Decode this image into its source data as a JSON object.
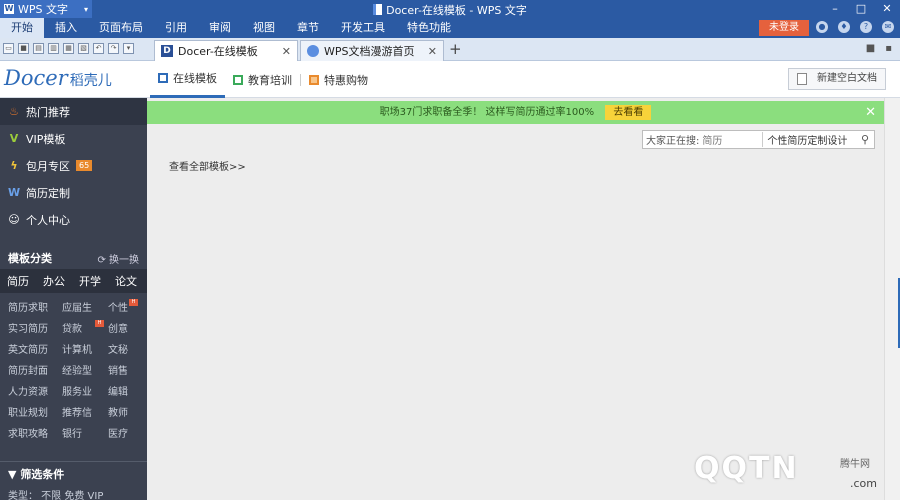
{
  "titlebar": {
    "app_menu": "WPS 文字",
    "title": "Docer-在线模板 - WPS 文字",
    "controls": [
      "–",
      "□",
      "✕"
    ]
  },
  "menubar": {
    "tabs": [
      "开始",
      "插入",
      "页面布局",
      "引用",
      "审阅",
      "视图",
      "章节",
      "开发工具",
      "特色功能"
    ],
    "login": "未登录",
    "icons": [
      "skin-icon",
      "share-icon",
      "help-icon",
      "feedback-icon"
    ]
  },
  "doctabs": [
    {
      "label": "Docer-在线模板",
      "active": true
    },
    {
      "label": "WPS文档漫游首页",
      "active": false
    }
  ],
  "docer": {
    "logo_en": "Docer",
    "logo_cn": "稻壳儿",
    "nav": [
      "在线模板",
      "教育培训",
      "特惠购物"
    ],
    "new_doc": "新建空白文档"
  },
  "sidebar": {
    "items": [
      {
        "label": "热门推荐",
        "icon": "flame-icon"
      },
      {
        "label": "VIP模板",
        "icon": "v-icon"
      },
      {
        "label": "包月专区",
        "icon": "lightning-icon",
        "badge": "65"
      },
      {
        "label": "简历定制",
        "icon": "w-icon"
      },
      {
        "label": "个人中心",
        "icon": "person-icon"
      }
    ],
    "section_title": "模板分类",
    "swap_label": "换一换",
    "category_tabs": [
      "简历",
      "办公",
      "开学",
      "论文"
    ],
    "categories": [
      "简历求职",
      "应届生",
      "个性",
      "实习简历",
      "贷款",
      "创意",
      "英文简历",
      "计算机",
      "文秘",
      "简历封面",
      "经验型",
      "销售",
      "人力资源",
      "服务业",
      "编辑",
      "职业规划",
      "推荐信",
      "教师",
      "求职攻略",
      "银行",
      "医疗"
    ],
    "filter_title": "筛选条件",
    "filter_row": "类型：  不限  免费  VIP"
  },
  "content": {
    "promo_text": "职场37门求职备全季！ 这样写简历通过率100%",
    "promo_button": "去看看",
    "search_label": "大家正在搜:",
    "search_value": "简历",
    "search_option": "个性简历定制设计",
    "view_all": "查看全部模板>>"
  },
  "watermark": {
    "main": "QQTN",
    "small": "腾牛网",
    "com": ".com"
  }
}
